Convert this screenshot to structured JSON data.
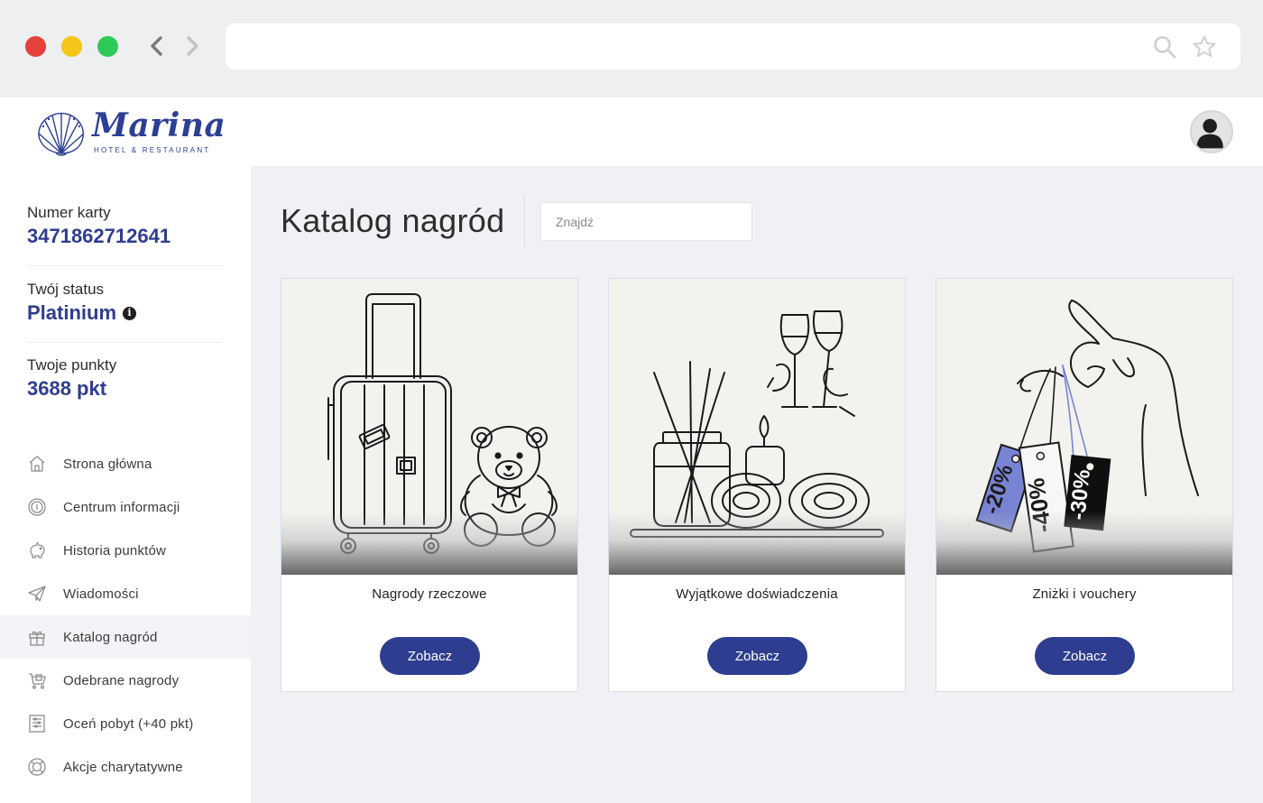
{
  "brand": {
    "name": "Marina",
    "tagline": "HOTEL & RESTAURANT",
    "logo_icon": "shell-logo-icon",
    "primary_color": "#2e3d8f"
  },
  "browser": {
    "icons": [
      "back-arrow-icon",
      "forward-arrow-icon",
      "search-icon",
      "star-icon"
    ]
  },
  "user": {
    "avatar_icon": "user-avatar-icon"
  },
  "account": {
    "card_number_label": "Numer karty",
    "card_number": "3471862712641",
    "status_label": "Twój status",
    "status": "Platinium",
    "status_info_icon": "i",
    "points_label": "Twoje punkty",
    "points": "3688 pkt"
  },
  "menu": {
    "items": [
      {
        "label": "Strona główna",
        "icon": "home-icon",
        "active": false
      },
      {
        "label": "Centrum informacji",
        "icon": "info-coin-icon",
        "active": false
      },
      {
        "label": "Historia punktów",
        "icon": "piggy-bank-icon",
        "active": false
      },
      {
        "label": "Wiadomości",
        "icon": "paper-plane-icon",
        "active": false
      },
      {
        "label": "Katalog nagród",
        "icon": "gift-icon",
        "active": true
      },
      {
        "label": "Odebrane nagrody",
        "icon": "gift-cart-icon",
        "active": false
      },
      {
        "label": "Oceń pobyt (+40 pkt)",
        "icon": "rating-form-icon",
        "active": false
      },
      {
        "label": "Akcje charytatywne",
        "icon": "lifebuoy-icon",
        "active": false
      }
    ]
  },
  "main": {
    "title": "Katalog nagród",
    "search_placeholder": "Znajdź",
    "cards": [
      {
        "title": "Nagrody rzeczowe",
        "button": "Zobacz",
        "image": "suitcase-teddy-bear-illustration"
      },
      {
        "title": "Wyjątkowe doświadczenia",
        "button": "Zobacz",
        "image": "spa-candles-wine-illustration"
      },
      {
        "title": "Zniżki i vouchery",
        "button": "Zobacz",
        "image": "discount-tags-hand-illustration",
        "tags": [
          "-20%",
          "-40%",
          "-30%"
        ]
      }
    ]
  }
}
